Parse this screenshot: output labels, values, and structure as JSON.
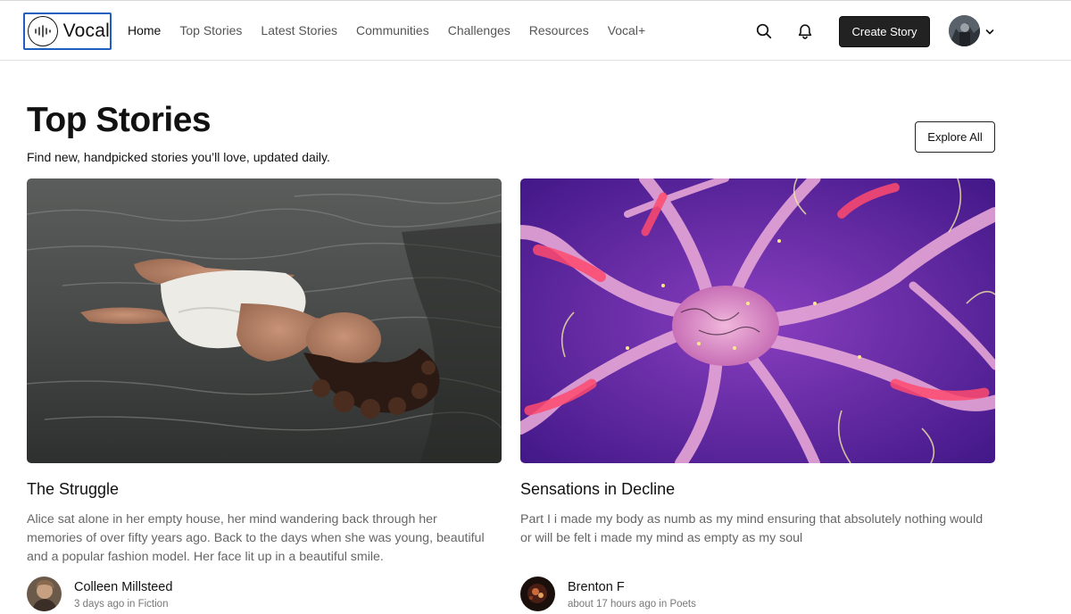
{
  "brand": {
    "name": "Vocal"
  },
  "nav": {
    "items": [
      {
        "label": "Home"
      },
      {
        "label": "Top Stories"
      },
      {
        "label": "Latest Stories"
      },
      {
        "label": "Communities"
      },
      {
        "label": "Challenges"
      },
      {
        "label": "Resources"
      },
      {
        "label": "Vocal+"
      }
    ]
  },
  "header_actions": {
    "create_label": "Create Story"
  },
  "page": {
    "title": "Top Stories",
    "subtitle": "Find new, handpicked stories you’ll love, updated daily.",
    "explore_label": "Explore All"
  },
  "stories": [
    {
      "title": "The Struggle",
      "excerpt": "Alice sat alone in her empty house, her mind wandering back through her memories of over fifty years ago. Back to the days when she was young, beautiful and a popular fashion model. Her face lit up in a beautiful smile.",
      "author": "Colleen Millsteed",
      "meta": "3 days ago in Fiction"
    },
    {
      "title": "Sensations in Decline",
      "excerpt": "Part I i made my body as numb as my mind ensuring that absolutely nothing would or will be felt i made my mind as empty as my soul",
      "author": "Brenton F",
      "meta": "about 17 hours ago in Poets"
    }
  ],
  "icons": {
    "logo": "sound-wave-icon",
    "search": "search-icon",
    "notifications": "bell-icon",
    "menu_caret": "chevron-down-icon"
  },
  "colors": {
    "primary_button": "#222222",
    "logo_focus_outline": "#1f5fbf"
  }
}
